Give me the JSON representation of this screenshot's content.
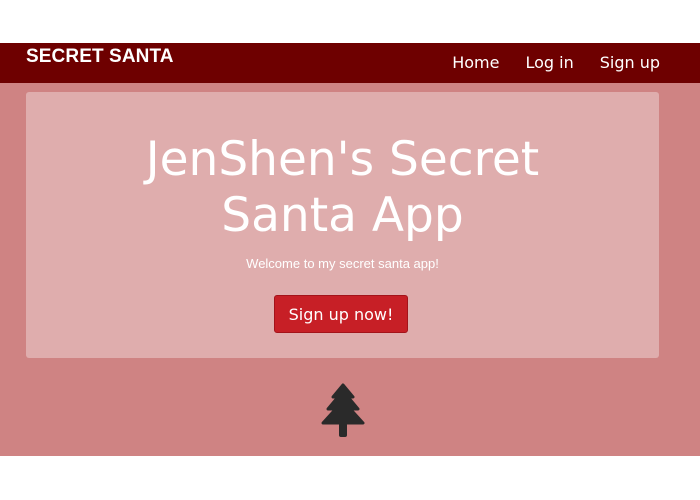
{
  "navbar": {
    "brand": "SECRET SANTA",
    "links": [
      {
        "label": "Home"
      },
      {
        "label": "Log in"
      },
      {
        "label": "Sign up"
      }
    ]
  },
  "hero": {
    "title_line1": "JenShen's Secret",
    "title_line2": "Santa App",
    "subtitle": "Welcome to my secret santa app!",
    "cta_label": "Sign up now!"
  },
  "decor": {
    "icon": "christmas-tree-icon"
  },
  "colors": {
    "navbar": "#6e0000",
    "page_background": "#cf8383",
    "jumbotron": "#dfadad",
    "button": "#c71f26",
    "tree": "#2a2a2a"
  }
}
